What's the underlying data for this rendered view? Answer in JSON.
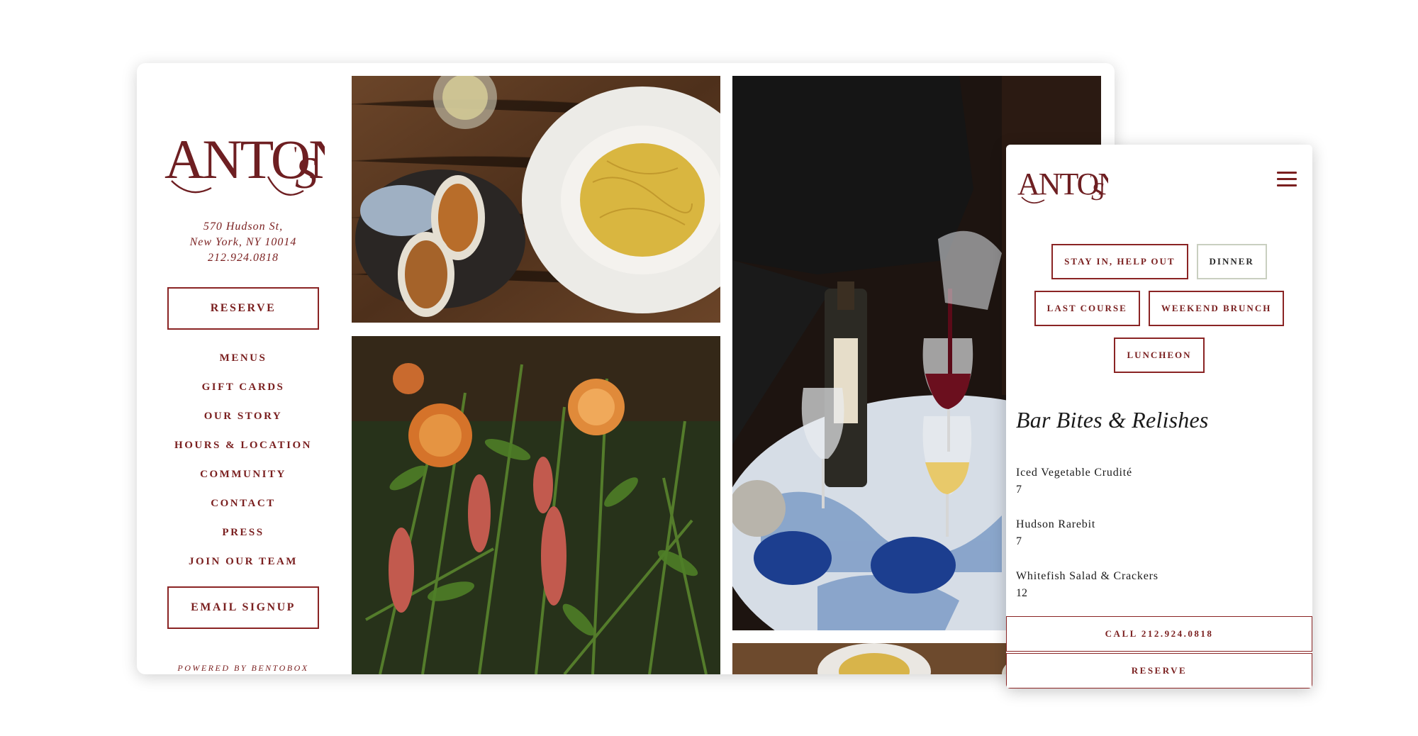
{
  "desktop": {
    "logo_text": "Anton's",
    "address": {
      "line1": "570 Hudson St,",
      "line2": "New York, NY 10014",
      "phone": "212.924.0818"
    },
    "reserve_label": "RESERVE",
    "nav_items": [
      "MENUS",
      "GIFT CARDS",
      "OUR STORY",
      "HOURS & LOCATION",
      "COMMUNITY",
      "CONTACT",
      "PRESS",
      "JOIN OUR TEAM"
    ],
    "email_signup_label": "EMAIL SIGNUP",
    "powered_by": "POWERED BY BENTOBOX"
  },
  "mobile": {
    "logo_text": "Anton's",
    "menu_icon": "hamburger-icon",
    "tabs": [
      {
        "label": "STAY IN, HELP OUT",
        "active": false
      },
      {
        "label": "DINNER",
        "active": true
      },
      {
        "label": "LAST COURSE",
        "active": false
      },
      {
        "label": "WEEKEND BRUNCH",
        "active": false
      },
      {
        "label": "LUNCHEON",
        "active": false
      }
    ],
    "section_title": "Bar Bites & Relishes",
    "items": [
      {
        "name": "Iced Vegetable Crudité",
        "price": "7"
      },
      {
        "name": "Hudson Rarebit",
        "price": "7"
      },
      {
        "name": "Whitefish Salad & Crackers",
        "price": "12"
      }
    ],
    "call_label": "CALL 212.924.0818",
    "reserve_label": "RESERVE"
  },
  "colors": {
    "brand": "#7a1f1f",
    "border": "#8a2424",
    "active_tab_border": "#c9cfc0"
  }
}
